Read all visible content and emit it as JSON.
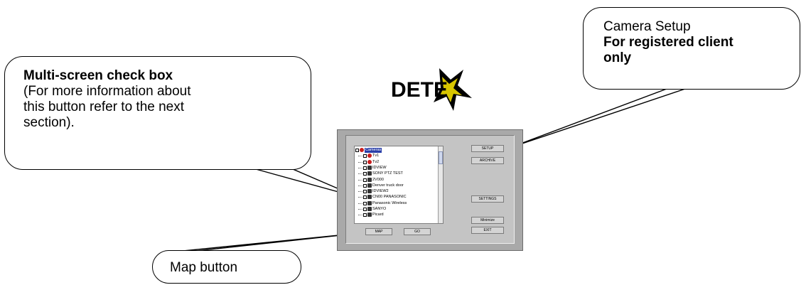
{
  "callouts": {
    "multiscreen": {
      "heading": "Multi-screen check box",
      "body_lines": [
        "(For more information about",
        "this button refer to the next",
        "section)."
      ]
    },
    "camera": {
      "line1": "Camera Setup",
      "bold_lines": [
        "For registered client",
        "only"
      ]
    },
    "map": {
      "text": "Map button"
    }
  },
  "logo": {
    "text": "DETE",
    "accent_color": "#d8c600"
  },
  "tree": {
    "items": [
      {
        "label": "Cameras",
        "icon": "root-icon",
        "selected": true
      },
      {
        "label": "Tv1",
        "icon": "red-dome-icon"
      },
      {
        "label": "Tv2",
        "icon": "red-dome-icon"
      },
      {
        "label": "IDVIEW",
        "icon": "camera-icon"
      },
      {
        "label": "SONY PTZ TEST",
        "icon": "camera-icon"
      },
      {
        "label": "2V000",
        "icon": "camera-icon"
      },
      {
        "label": "Denver truck door",
        "icon": "camera-icon"
      },
      {
        "label": "IDVIEW2",
        "icon": "camera-icon"
      },
      {
        "label": "CN00 PANASONIC",
        "icon": "camera-icon"
      },
      {
        "label": "Panasonic Wireless",
        "icon": "camera-icon"
      },
      {
        "label": "SANYO",
        "icon": "camera-icon"
      },
      {
        "label": "Picard",
        "icon": "camera-icon"
      }
    ]
  },
  "buttons": {
    "map": "MAP",
    "go": "GO",
    "setup": "SETUP",
    "archive": "ARCHIVE",
    "settings": "SETTINGS",
    "minimize": "Minimize",
    "exit": "EXIT"
  }
}
